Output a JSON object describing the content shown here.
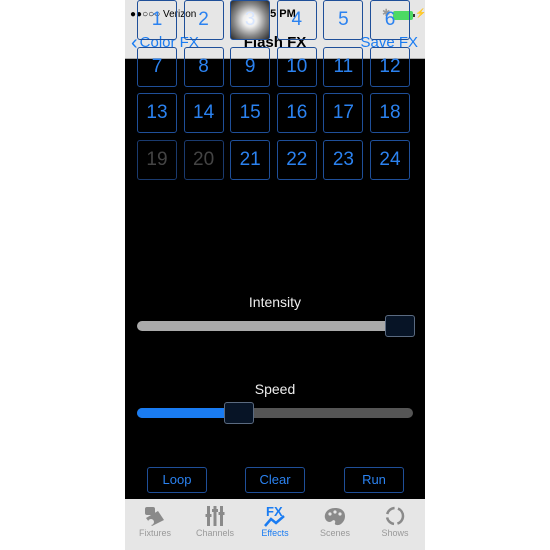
{
  "status_bar": {
    "carrier": "●●○○○ Verizon",
    "time": "4:15 PM",
    "bluetooth_icon": "bluetooth-icon",
    "battery_icon": "battery-charging-icon"
  },
  "nav": {
    "back_label": "Color FX",
    "title": "Flash FX",
    "save_label": "Save FX"
  },
  "grid": {
    "cells": [
      {
        "label": "1",
        "state": "normal"
      },
      {
        "label": "2",
        "state": "normal"
      },
      {
        "label": "3",
        "state": "active"
      },
      {
        "label": "4",
        "state": "normal"
      },
      {
        "label": "5",
        "state": "normal"
      },
      {
        "label": "6",
        "state": "normal"
      },
      {
        "label": "7",
        "state": "normal"
      },
      {
        "label": "8",
        "state": "normal"
      },
      {
        "label": "9",
        "state": "normal"
      },
      {
        "label": "10",
        "state": "normal"
      },
      {
        "label": "11",
        "state": "normal"
      },
      {
        "label": "12",
        "state": "normal"
      },
      {
        "label": "13",
        "state": "normal"
      },
      {
        "label": "14",
        "state": "normal"
      },
      {
        "label": "15",
        "state": "normal"
      },
      {
        "label": "16",
        "state": "normal"
      },
      {
        "label": "17",
        "state": "normal"
      },
      {
        "label": "18",
        "state": "normal"
      },
      {
        "label": "19",
        "state": "disabled"
      },
      {
        "label": "20",
        "state": "disabled"
      },
      {
        "label": "21",
        "state": "normal"
      },
      {
        "label": "22",
        "state": "normal"
      },
      {
        "label": "23",
        "state": "normal"
      },
      {
        "label": "24",
        "state": "normal"
      }
    ]
  },
  "intensity": {
    "label": "Intensity",
    "value": 1.0
  },
  "speed": {
    "label": "Speed",
    "value": 0.35
  },
  "buttons": {
    "loop": "Loop",
    "clear": "Clear",
    "run": "Run"
  },
  "tabs": [
    {
      "label": "Fixtures",
      "icon": "fixture-light-icon",
      "selected": false
    },
    {
      "label": "Channels",
      "icon": "sliders-icon",
      "selected": false
    },
    {
      "label": "Effects",
      "icon": "fx-icon",
      "selected": true
    },
    {
      "label": "Scenes",
      "icon": "palette-icon",
      "selected": false
    },
    {
      "label": "Shows",
      "icon": "cycle-icon",
      "selected": false
    }
  ],
  "colors": {
    "accent": "#1a7cf2",
    "cell_border": "#1f4f99",
    "intensity_track": "#aaaaaa",
    "speed_fill": "#1a7cf2",
    "speed_track": "#555555",
    "inactive_tab": "#999999"
  }
}
